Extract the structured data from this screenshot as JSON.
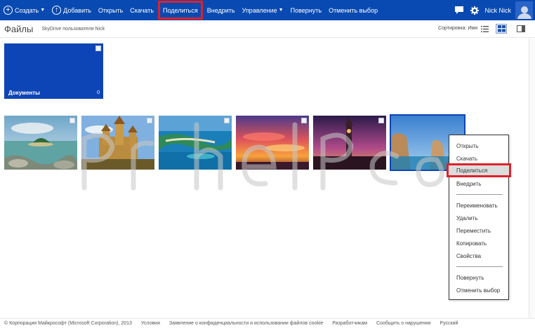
{
  "toolbar": {
    "create_label": "Создать",
    "upload_label": "Добавить",
    "open_label": "Открыть",
    "download_label": "Скачать",
    "share_label": "Поделиться",
    "embed_label": "Внедрить",
    "manage_label": "Управление",
    "rotate_label": "Повернуть",
    "clear_label": "Отменить выбор",
    "user_name": "Nick Nick"
  },
  "header": {
    "title": "Файлы",
    "subtitle": "SkyDrive пользователя Nick",
    "sort_label": "Сортировка: Имя"
  },
  "folder": {
    "name": "Документы",
    "count": "0"
  },
  "photos": [
    {
      "name": "tropical-island-photo",
      "selected": false
    },
    {
      "name": "castle-photo",
      "selected": false
    },
    {
      "name": "lagoon-aerial-photo",
      "selected": false
    },
    {
      "name": "sunset-sky-photo",
      "selected": false
    },
    {
      "name": "big-ben-photo",
      "selected": false
    },
    {
      "name": "sea-cliffs-photo",
      "selected": true
    }
  ],
  "context_menu": {
    "open": "Открыть",
    "download": "Скачать",
    "share": "Поделиться",
    "embed": "Внедрить",
    "rename": "Переименовать",
    "delete": "Удалить",
    "move": "Переместить",
    "copy": "Копировать",
    "properties": "Свойства",
    "rotate": "Повернуть",
    "clear_selection": "Отменить выбор"
  },
  "footer": {
    "copyright": "© Корпорация Майкрософт (Microsoft Corporation), 2013",
    "terms": "Условия",
    "privacy": "Заявление о конфиденциальности и использовании файлов cookie",
    "developers": "Разработчикам",
    "report": "Сообщить о нарушении",
    "language": "Русский"
  },
  "colors": {
    "accent": "#094ab2",
    "highlight_border": "#e0202a"
  }
}
